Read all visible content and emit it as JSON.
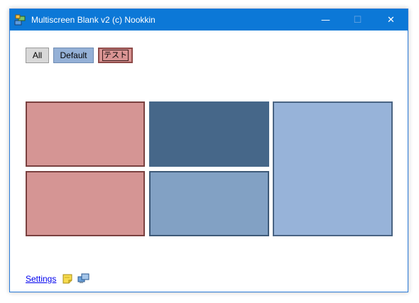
{
  "window": {
    "title": "Multiscreen Blank v2 (c) Nookkin",
    "controls": {
      "minimize": "—",
      "maximize": "☐",
      "close": "✕"
    }
  },
  "tabs": [
    {
      "label": "All",
      "color": "#d8d8d8"
    },
    {
      "label": "Default",
      "color": "#94b0d6"
    },
    {
      "label": "テスト",
      "color": "#d99493",
      "selected": true
    }
  ],
  "screens": [
    {
      "id": 1,
      "color": "#d59594"
    },
    {
      "id": 2,
      "color": "#466789"
    },
    {
      "id": 3,
      "color": "#97b3d9"
    },
    {
      "id": 4,
      "color": "#d59594"
    },
    {
      "id": 5,
      "color": "#82a1c4"
    }
  ],
  "footer": {
    "settings_label": "Settings",
    "icons": [
      "sticky-note-icon",
      "screens-icon"
    ]
  },
  "colors": {
    "titlebar": "#0c78d7",
    "accent_red": "#d59594",
    "accent_blue": "#97b3d9"
  }
}
